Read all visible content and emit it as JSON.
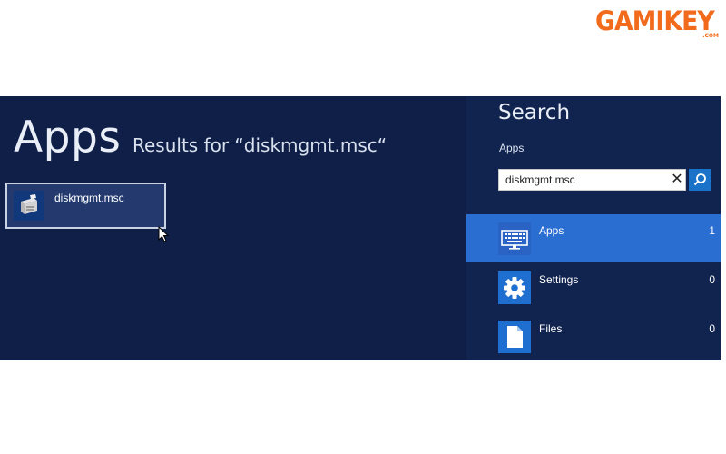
{
  "watermark": {
    "logo_text": "GAMIKEY",
    "logo_sub": ".COM",
    "color": "#f26a1b"
  },
  "results": {
    "heading": "Apps",
    "results_for": "Results for “diskmgmt.msc“",
    "items": [
      {
        "label": "diskmgmt.msc",
        "icon": "disk-management-icon"
      }
    ]
  },
  "search_charm": {
    "title": "Search",
    "scope_label": "Apps",
    "input_value": "diskmgmt.msc",
    "clear_symbol": "✕",
    "filters": [
      {
        "label": "Apps",
        "count": "1",
        "icon": "apps-keyboard-icon",
        "active": true
      },
      {
        "label": "Settings",
        "count": "0",
        "icon": "gear-icon",
        "active": false
      },
      {
        "label": "Files",
        "count": "0",
        "icon": "file-icon",
        "active": false
      }
    ]
  },
  "colors": {
    "background": "#0f1f47",
    "charm_background": "#11244f",
    "accent": "#2b6ed1",
    "search_button": "#1a73c8"
  }
}
